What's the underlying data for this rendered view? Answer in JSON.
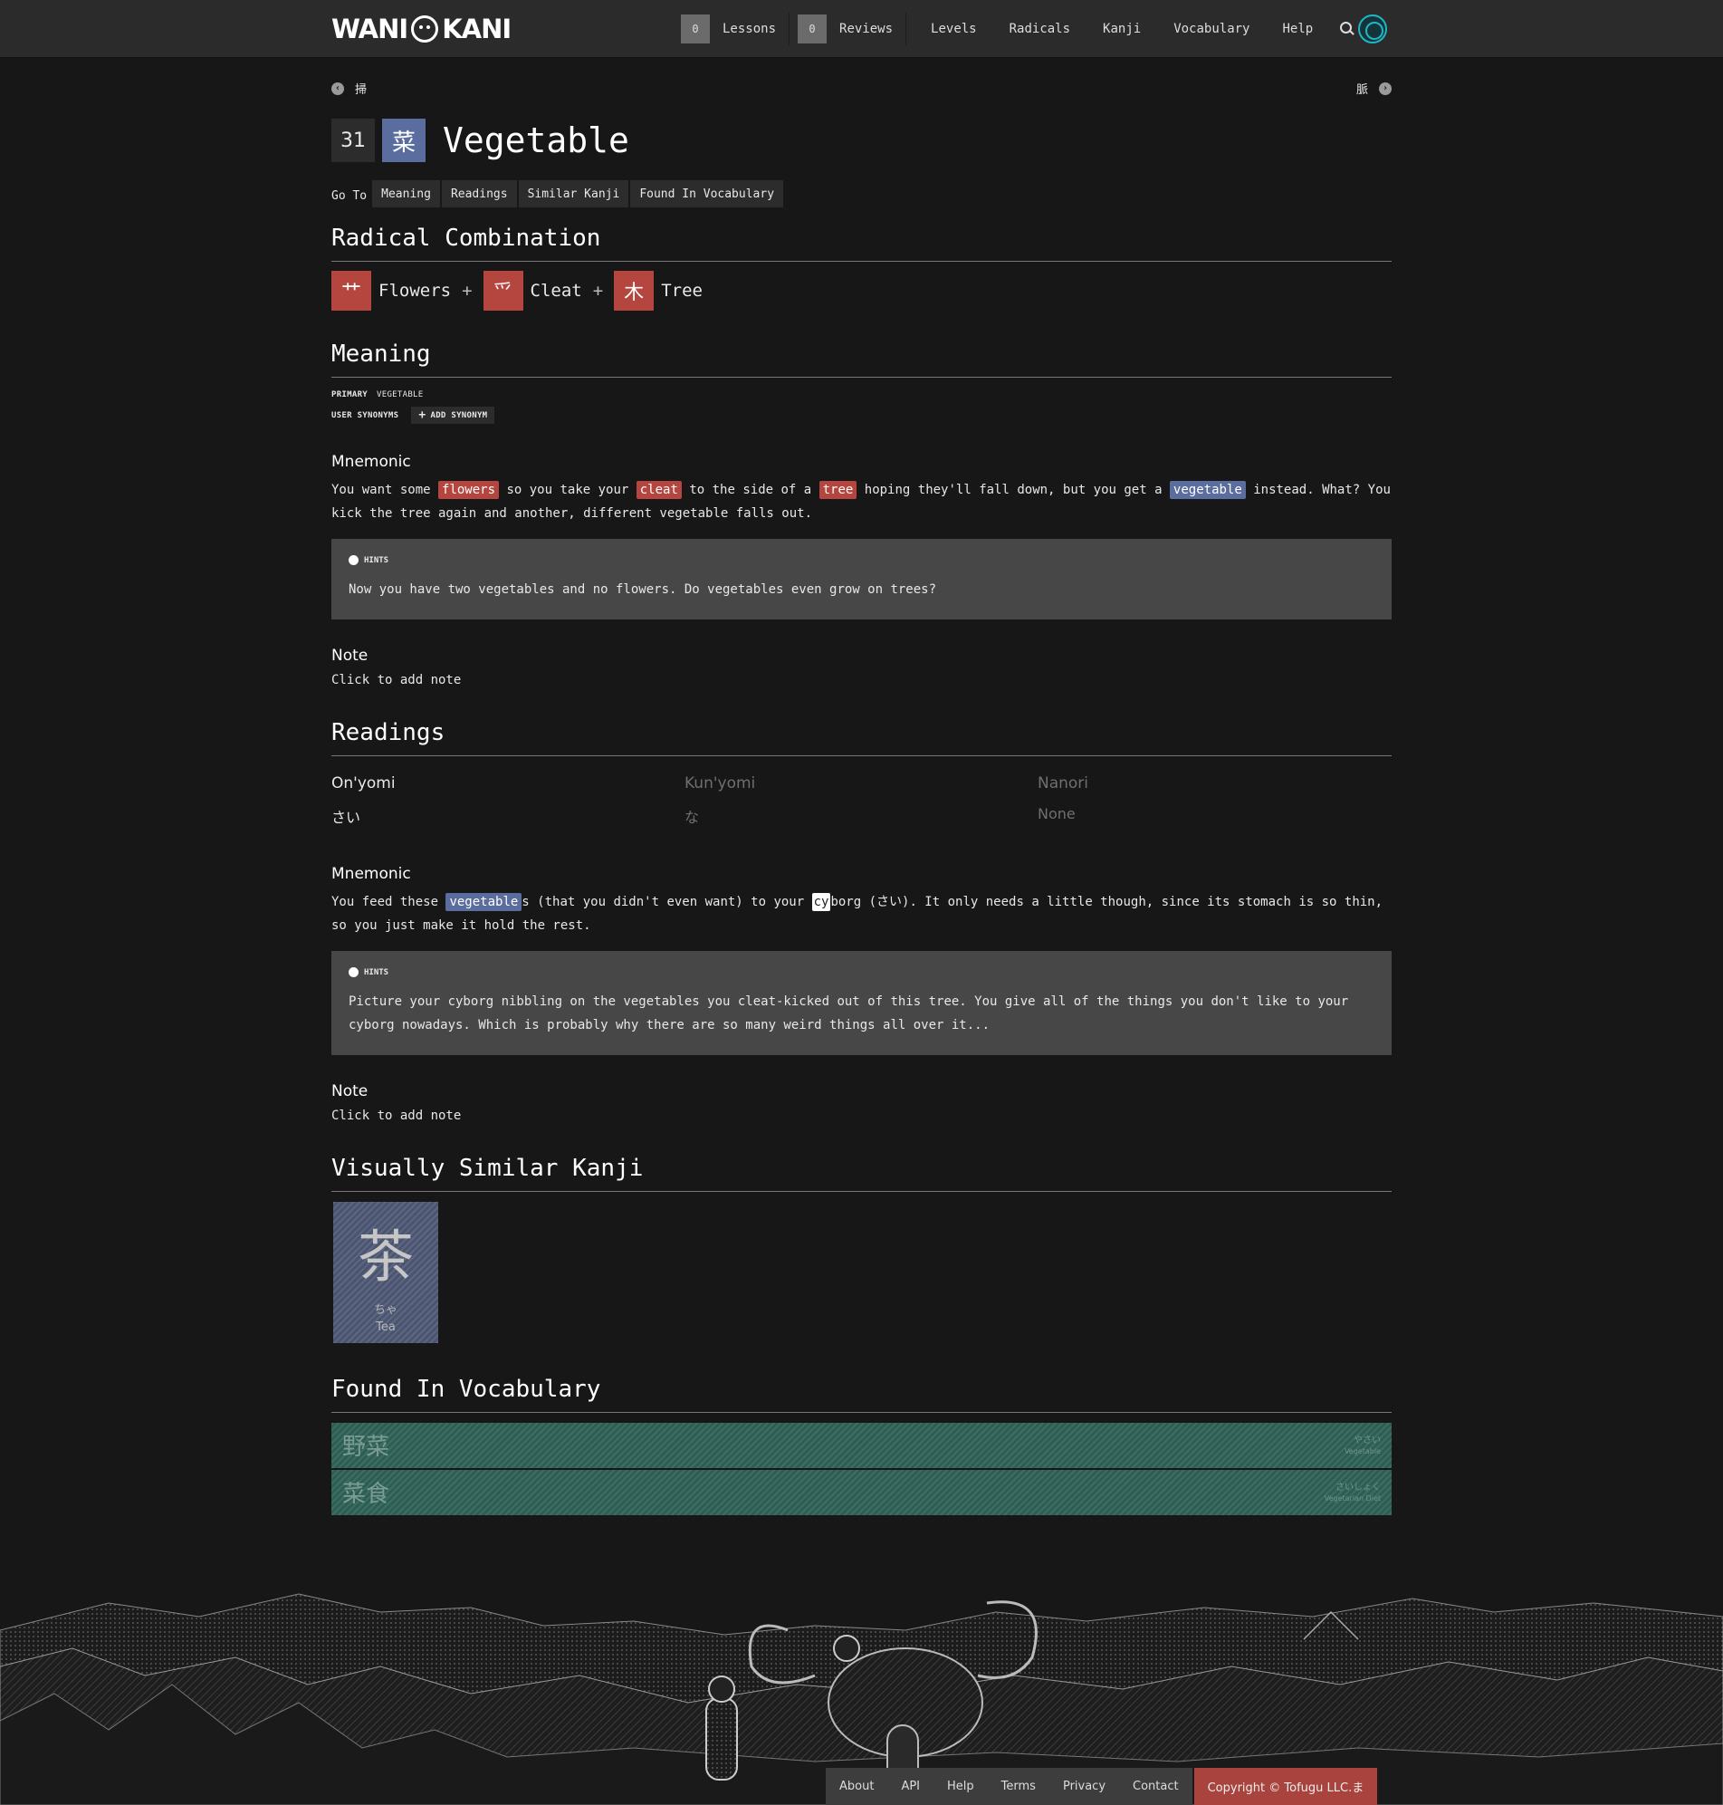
{
  "nav": {
    "logo": "WANI KANI",
    "lessons_count": "0",
    "lessons_label": "Lessons",
    "reviews_count": "0",
    "reviews_label": "Reviews",
    "links": [
      "Levels",
      "Radicals",
      "Kanji",
      "Vocabulary",
      "Help"
    ]
  },
  "pager": {
    "prev": "掃",
    "next": "脈"
  },
  "header": {
    "level": "31",
    "kanji": "菜",
    "meaning": "Vegetable"
  },
  "goto": {
    "label": "Go To",
    "buttons": [
      "Meaning",
      "Readings",
      "Similar Kanji",
      "Found In Vocabulary"
    ]
  },
  "radical_combination": {
    "title": "Radical Combination",
    "radicals": [
      {
        "char": "艹",
        "name": "Flowers"
      },
      {
        "char": "爫",
        "name": "Cleat"
      },
      {
        "char": "木",
        "name": "Tree"
      }
    ],
    "plus": "+"
  },
  "meaning": {
    "title": "Meaning",
    "primary_label": "PRIMARY",
    "primary_value": "VEGETABLE",
    "synonyms_label": "USER SYNONYMS",
    "add_synonym": "ADD SYNONYM",
    "mnemonic_title": "Mnemonic",
    "mnemonic": {
      "t1": "You want some ",
      "flowers": "flowers",
      "t2": " so you take your ",
      "cleat": "cleat",
      "t3": " to the side of a ",
      "tree": "tree",
      "t4": " hoping they'll fall down, but you get a ",
      "vegetable": "vegetable",
      "t5": " instead. What? You kick the tree again and another, different vegetable falls out."
    },
    "hints_label": "HINTS",
    "hint": "Now you have two vegetables and no flowers. Do vegetables even grow on trees?",
    "note_title": "Note",
    "note": "Click to add note"
  },
  "readings": {
    "title": "Readings",
    "onyomi_label": "On'yomi",
    "onyomi": "さい",
    "kunyomi_label": "Kun'yomi",
    "kunyomi": "な",
    "nanori_label": "Nanori",
    "nanori": "None",
    "mnemonic_title": "Mnemonic",
    "mnemonic": {
      "t1": "You feed these ",
      "vegetable": "vegetable",
      "t2": "s (that you didn't even want) to your ",
      "cy": "cy",
      "t3": "borg (さい). It only needs a little though, since its stomach is so thin, so you just make it hold the rest."
    },
    "hints_label": "HINTS",
    "hint": "Picture your cyborg nibbling on the vegetables you cleat-kicked out of this tree. You give all of the things you don't like to your cyborg nowadays. Which is probably why there are so many weird things all over it...",
    "note_title": "Note",
    "note": "Click to add note"
  },
  "similar": {
    "title": "Visually Similar Kanji",
    "items": [
      {
        "kanji": "茶",
        "reading": "ちゃ",
        "meaning": "Tea"
      }
    ]
  },
  "vocabulary": {
    "title": "Found In Vocabulary",
    "items": [
      {
        "word": "野菜",
        "reading": "やさい",
        "meaning": "Vegetable"
      },
      {
        "word": "菜食",
        "reading": "さいしょく",
        "meaning": "Vegetarian Diet"
      }
    ]
  },
  "footer": {
    "links": [
      "About",
      "API",
      "Help",
      "Terms",
      "Privacy",
      "Contact"
    ],
    "copyright": "Copyright © Tofugu LLC.ま"
  },
  "colors": {
    "radical": "#b5463f",
    "kanji": "#5a6d9e",
    "vocab": "#3b6f64",
    "accent": "#1fb6c4"
  }
}
